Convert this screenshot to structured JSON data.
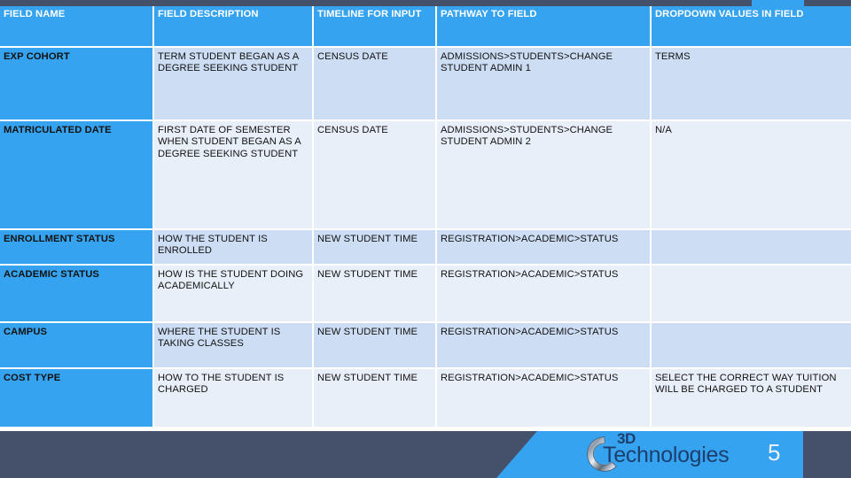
{
  "theme": {
    "accent_blue": "#36a3f0",
    "dark_slate": "#45516b",
    "row_light": "#e8eff9",
    "row_dark": "#ccddf4",
    "header_text": "#ffffff"
  },
  "table": {
    "columns": [
      "FIELD NAME",
      "FIELD DESCRIPTION",
      "TIMELINE FOR INPUT",
      "PATHWAY TO FIELD",
      "DROPDOWN VALUES IN FIELD"
    ],
    "rows": [
      {
        "field_name": "EXP COHORT",
        "field_description": "TERM STUDENT BEGAN AS A DEGREE SEEKING STUDENT",
        "timeline_for_input": "CENSUS DATE",
        "pathway_to_field": "ADMISSIONS>STUDENTS>CHANGE STUDENT ADMIN 1",
        "dropdown_values": "TERMS"
      },
      {
        "field_name": "MATRICULATED DATE",
        "field_description": "FIRST DATE OF SEMESTER WHEN STUDENT BEGAN AS A DEGREE SEEKING STUDENT",
        "timeline_for_input": "CENSUS DATE",
        "pathway_to_field": "ADMISSIONS>STUDENTS>CHANGE STUDENT ADMIN 2",
        "dropdown_values": "N/A"
      },
      {
        "field_name": "ENROLLMENT STATUS",
        "field_description": "HOW THE STUDENT IS ENROLLED",
        "timeline_for_input": "NEW STUDENT TIME",
        "pathway_to_field": "REGISTRATION>ACADEMIC>STATUS",
        "dropdown_values": ""
      },
      {
        "field_name": "ACADEMIC STATUS",
        "field_description": "HOW IS THE STUDENT DOING ACADEMICALLY",
        "timeline_for_input": "NEW STUDENT TIME",
        "pathway_to_field": "REGISTRATION>ACADEMIC>STATUS",
        "dropdown_values": ""
      },
      {
        "field_name": "CAMPUS",
        "field_description": "WHERE THE STUDENT IS TAKING CLASSES",
        "timeline_for_input": "NEW STUDENT TIME",
        "pathway_to_field": "REGISTRATION>ACADEMIC>STATUS",
        "dropdown_values": ""
      },
      {
        "field_name": "COST TYPE",
        "field_description": "HOW TO THE STUDENT IS CHARGED",
        "timeline_for_input": "NEW STUDENT TIME",
        "pathway_to_field": "REGISTRATION>ACADEMIC>STATUS",
        "dropdown_values": "SELECT THE CORRECT WAY TUITION WILL BE CHARGED TO A STUDENT"
      }
    ]
  },
  "footer": {
    "logo_top_text": "3D",
    "logo_word": "Technologies",
    "page_number": "5"
  }
}
